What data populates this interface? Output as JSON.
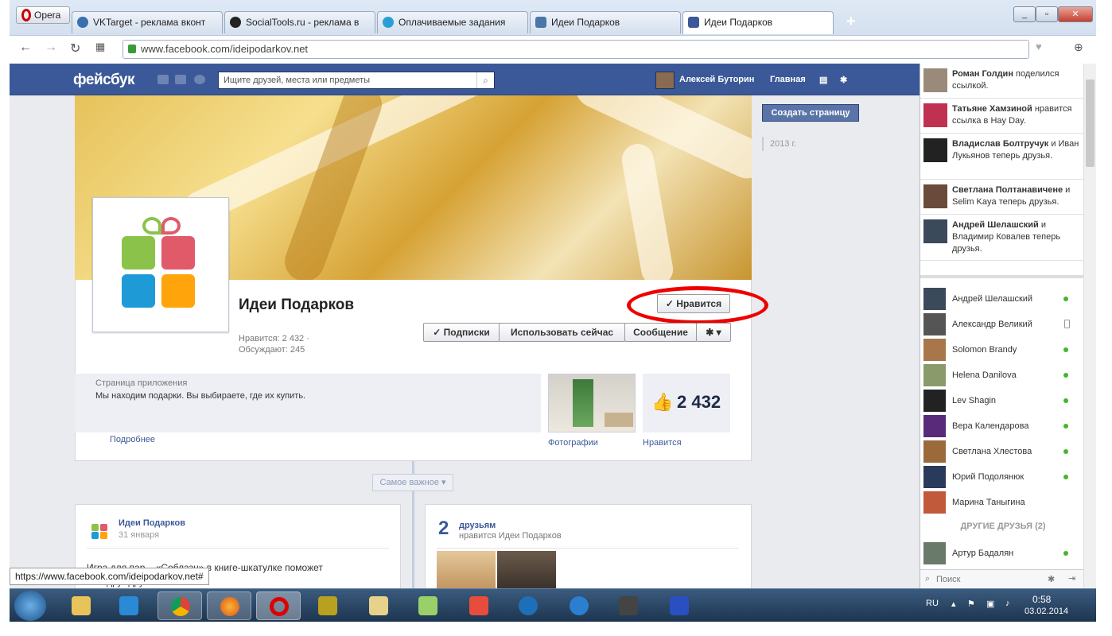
{
  "browser": {
    "menu_label": "Opera",
    "tabs": [
      {
        "label": "VKTarget - реклама вконт",
        "icon": "vktarget-icon"
      },
      {
        "label": "SocialTools.ru - реклама в",
        "icon": "socialtools-icon"
      },
      {
        "label": "Оплачиваемые задания",
        "icon": "globe-icon"
      },
      {
        "label": "Идеи Подарков",
        "icon": "vk-icon"
      },
      {
        "label": "Идеи Подарков",
        "icon": "facebook-icon"
      }
    ],
    "url": "www.facebook.com/ideipodarkov.net",
    "status_url": "https://www.facebook.com/ideipodarkov.net#"
  },
  "fb": {
    "logo": "фейсбук",
    "search_placeholder": "Ищите друзей, места или предметы",
    "user_name": "Алексей Буторин",
    "home": "Главная",
    "page": {
      "name": "Идеи Подарков",
      "likes_stat": "Нравится: 2 432 ·",
      "talking_stat": "Обсуждают: 245",
      "like_button": "Нравится",
      "subscriptions_button": "Подписки",
      "use_now_button": "Использовать сейчас",
      "message_button": "Сообщение",
      "app_page_label": "Страница приложения",
      "description": "Мы находим подарки. Вы выбираете, где их купить.",
      "more_link": "Подробнее",
      "photos_link": "Фотографии",
      "likes_link": "Нравится",
      "likes_count": "2 432",
      "important_dropdown": "Самое важное",
      "create_page": "Создать страницу",
      "year": "2013 г."
    },
    "post": {
      "author": "Идеи Подарков",
      "date": "31 января",
      "text_line1": "Игра для пар... «Соблазн» в книге-шкатулке поможет",
      "text_line2": "...ть друг друга!"
    },
    "friends_card": {
      "count": "2",
      "title": "друзьям",
      "subtitle": "нравится Идеи Подарков"
    },
    "ticker": [
      {
        "name": "Роман Голдин",
        "rest": " поделился ссылкой."
      },
      {
        "name": "Татьяне Хамзиной",
        "rest": " нравится ссылка в Hay Day."
      },
      {
        "name": "Владислав Болтручук",
        "rest": " и Иван Лукьянов теперь друзья."
      },
      {
        "name": "Светлана Полтанавичене",
        "rest": " и Selim Kaya теперь друзья."
      },
      {
        "name": "Андрей Шелашский",
        "rest": " и Владимир Ковалев теперь друзья."
      }
    ],
    "chat": [
      {
        "name": "Андрей Шелашский",
        "status": "online"
      },
      {
        "name": "Александр Великий",
        "status": "mobile"
      },
      {
        "name": "Solomon Brandy",
        "status": "online"
      },
      {
        "name": "Helena Danilova",
        "status": "online"
      },
      {
        "name": "Lev Shagin",
        "status": "online"
      },
      {
        "name": "Вера Календарова",
        "status": "online"
      },
      {
        "name": "Светлана Хлестова",
        "status": "online"
      },
      {
        "name": "Юрий Подолянюк",
        "status": "online"
      },
      {
        "name": "Марина Таныгина",
        "status": ""
      }
    ],
    "other_friends_label": "ДРУГИЕ ДРУЗЬЯ (2)",
    "other_friend": "Артур Бадалян",
    "chat_search": "Поиск"
  },
  "taskbar": {
    "lang": "RU",
    "time": "0:58",
    "date": "03.02.2014"
  },
  "colors": {
    "fb_blue": "#3b5998",
    "highlight_oval": "#e00000",
    "online": "#42b72a"
  }
}
